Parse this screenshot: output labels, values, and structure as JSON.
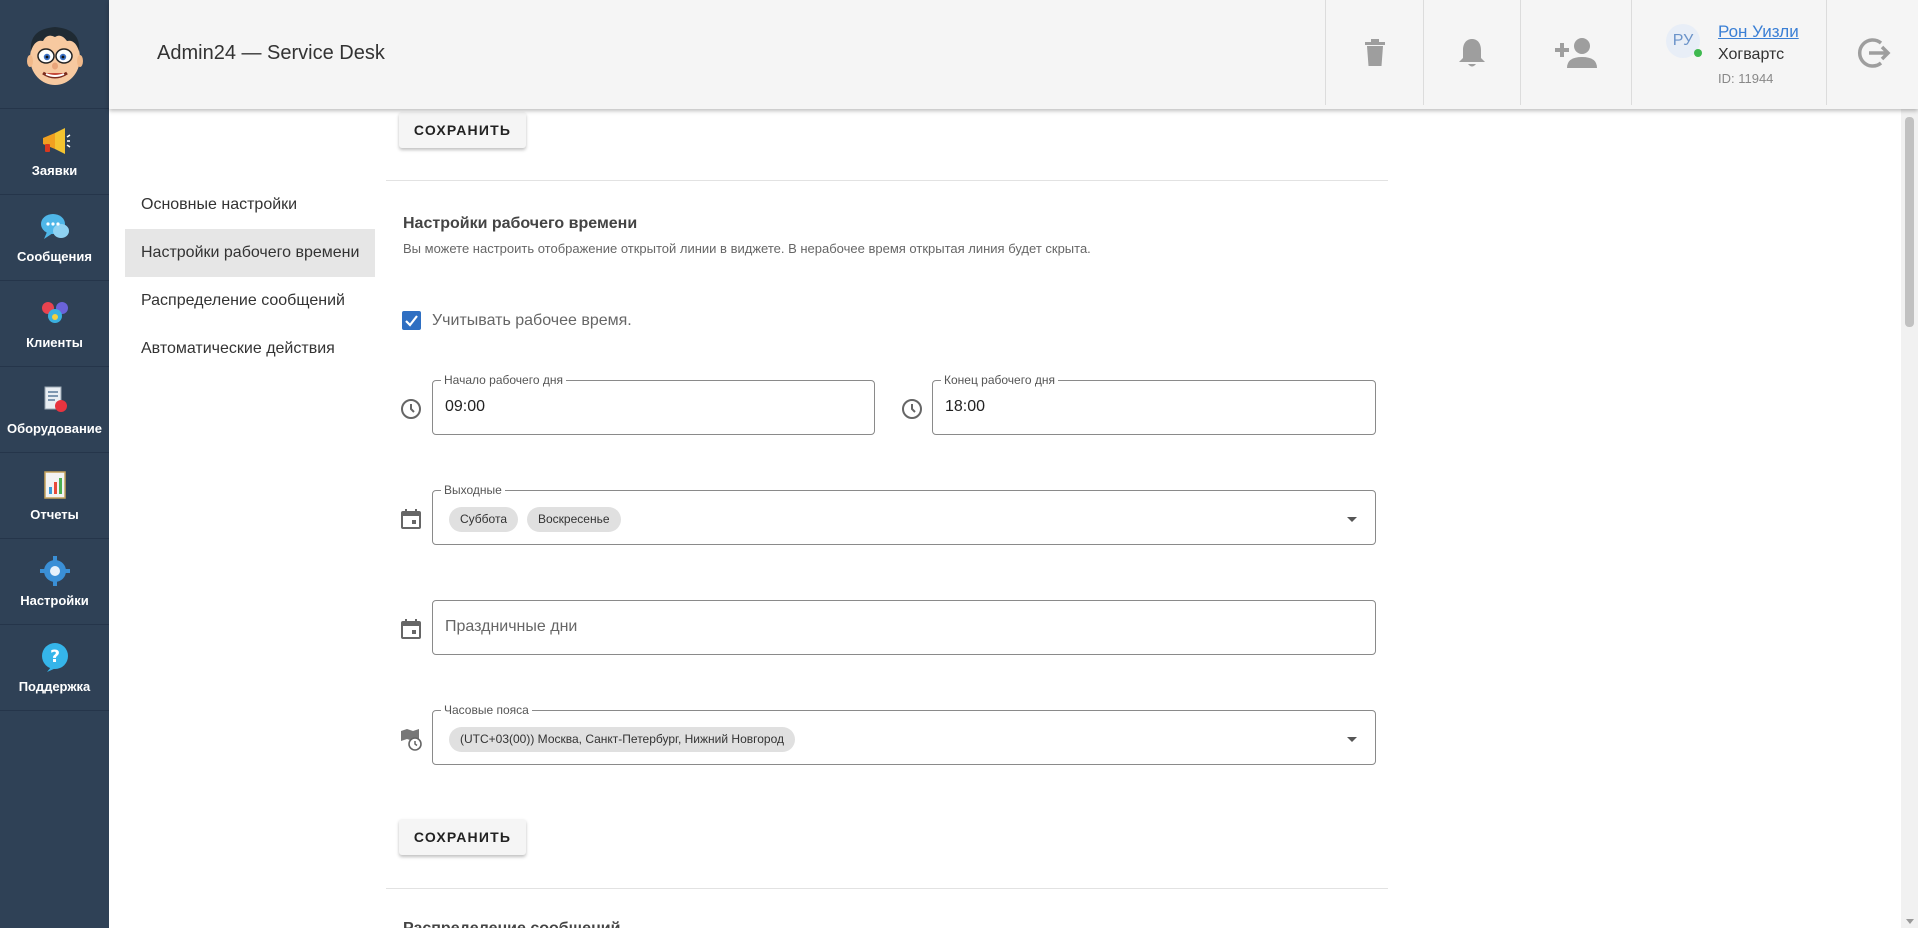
{
  "sidebar": {
    "logo_icon": "cartoon-face-icon",
    "items": [
      {
        "label": "Заявки",
        "icon": "megaphone-icon"
      },
      {
        "label": "Сообщения",
        "icon": "chat-bubble-icon"
      },
      {
        "label": "Клиенты",
        "icon": "people-icon"
      },
      {
        "label": "Оборудование",
        "icon": "equipment-icon"
      },
      {
        "label": "Отчеты",
        "icon": "report-icon"
      },
      {
        "label": "Настройки",
        "icon": "gear-icon"
      },
      {
        "label": "Поддержка",
        "icon": "question-icon"
      }
    ]
  },
  "header": {
    "title": "Admin24 — Service Desk",
    "icons": [
      "trash-icon",
      "bell-icon",
      "add-user-icon",
      "logout-icon"
    ],
    "user": {
      "initials": "РУ",
      "name": "Рон Уизли",
      "org": "Хогвартс",
      "id": "ID: 11944",
      "status_color": "#3fb950"
    }
  },
  "settings_menu": {
    "items": [
      {
        "label": "Основные настройки",
        "active": false
      },
      {
        "label": "Настройки рабочего времени",
        "active": true
      },
      {
        "label": "Распределение сообщений",
        "active": false
      },
      {
        "label": "Автоматические действия",
        "active": false
      }
    ]
  },
  "main": {
    "save_label": "СОХРАНИТЬ",
    "section_title": "Настройки рабочего времени",
    "section_desc": "Вы можете настроить отображение открытой линии в виджете. В нерабочее время открытая линия будет скрыта.",
    "use_working_time": {
      "label": "Учитывать рабочее время.",
      "checked": true
    },
    "work_start": {
      "label": "Начало рабочего дня",
      "value": "09:00"
    },
    "work_end": {
      "label": "Конец рабочего дня",
      "value": "18:00"
    },
    "weekends": {
      "label": "Выходные",
      "chips": [
        "Суббота",
        "Воскресенье"
      ]
    },
    "holidays": {
      "placeholder": "Праздничные дни"
    },
    "timezone": {
      "label": "Часовые пояса",
      "chips": [
        "(UTC+03(00)) Москва, Санкт-Петербург, Нижний Новгород"
      ]
    },
    "next_section_title": "Распределение сообщений"
  },
  "colors": {
    "sidebar_bg": "#2f4156",
    "accent": "#2f6fc2",
    "link": "#3a7fd5"
  }
}
